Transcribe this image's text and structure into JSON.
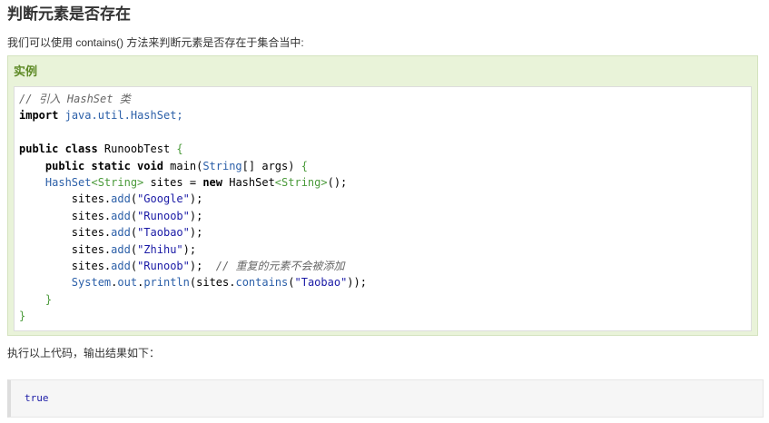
{
  "page": {
    "title": "判断元素是否存在",
    "intro": "我们可以使用 contains() 方法来判断元素是否存在于集合当中:",
    "result_text": "执行以上代码，输出结果如下："
  },
  "example": {
    "label": "实例",
    "lines": [
      [
        {
          "t": "// 引入 HashSet 类",
          "c": "comment"
        }
      ],
      [
        {
          "t": "import",
          "c": "kw"
        },
        {
          "t": " "
        },
        {
          "t": "java.util.HashSet;",
          "c": "typ"
        }
      ],
      [],
      [
        {
          "t": "public class",
          "c": "kw"
        },
        {
          "t": " RunoobTest "
        },
        {
          "t": "{",
          "c": "brace"
        }
      ],
      [
        {
          "t": "    "
        },
        {
          "t": "public static void",
          "c": "kw"
        },
        {
          "t": " main("
        },
        {
          "t": "String",
          "c": "typ"
        },
        {
          "t": "[] args) "
        },
        {
          "t": "{",
          "c": "brace"
        }
      ],
      [
        {
          "t": "    "
        },
        {
          "t": "HashSet",
          "c": "typ"
        },
        {
          "t": "<String>",
          "c": "brace"
        },
        {
          "t": " sites = "
        },
        {
          "t": "new",
          "c": "kw"
        },
        {
          "t": " HashSet"
        },
        {
          "t": "<String>",
          "c": "brace"
        },
        {
          "t": "();"
        }
      ],
      [
        {
          "t": "        sites."
        },
        {
          "t": "add",
          "c": "fn"
        },
        {
          "t": "("
        },
        {
          "t": "\"Google\"",
          "c": "str"
        },
        {
          "t": ");"
        }
      ],
      [
        {
          "t": "        sites."
        },
        {
          "t": "add",
          "c": "fn"
        },
        {
          "t": "("
        },
        {
          "t": "\"Runoob\"",
          "c": "str"
        },
        {
          "t": ");"
        }
      ],
      [
        {
          "t": "        sites."
        },
        {
          "t": "add",
          "c": "fn"
        },
        {
          "t": "("
        },
        {
          "t": "\"Taobao\"",
          "c": "str"
        },
        {
          "t": ");"
        }
      ],
      [
        {
          "t": "        sites."
        },
        {
          "t": "add",
          "c": "fn"
        },
        {
          "t": "("
        },
        {
          "t": "\"Zhihu\"",
          "c": "str"
        },
        {
          "t": ");"
        }
      ],
      [
        {
          "t": "        sites."
        },
        {
          "t": "add",
          "c": "fn"
        },
        {
          "t": "("
        },
        {
          "t": "\"Runoob\"",
          "c": "str"
        },
        {
          "t": ");  "
        },
        {
          "t": "// 重复的元素不会被添加",
          "c": "comment"
        }
      ],
      [
        {
          "t": "        "
        },
        {
          "t": "System",
          "c": "sys"
        },
        {
          "t": "."
        },
        {
          "t": "out",
          "c": "sys"
        },
        {
          "t": "."
        },
        {
          "t": "println",
          "c": "fn"
        },
        {
          "t": "(sites."
        },
        {
          "t": "contains",
          "c": "fn"
        },
        {
          "t": "("
        },
        {
          "t": "\"Taobao\"",
          "c": "str"
        },
        {
          "t": "));"
        }
      ],
      [
        {
          "t": "    "
        },
        {
          "t": "}",
          "c": "brace"
        }
      ],
      [
        {
          "t": "}",
          "c": "brace"
        }
      ]
    ]
  },
  "output": {
    "text": "true"
  },
  "colors": {
    "example_bg": "#e9f3d9",
    "example_label": "#5e8a26",
    "string": "#1a1aa6",
    "type": "#2b5fa8",
    "brace": "#4a9a3a",
    "comment": "#666666"
  }
}
